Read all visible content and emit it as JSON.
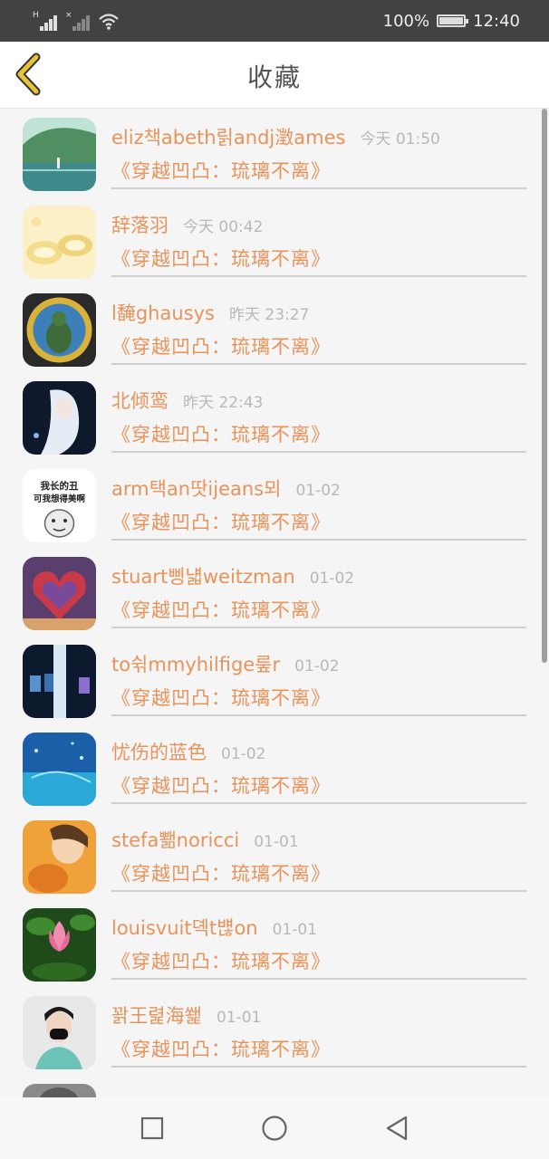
{
  "status_bar": {
    "battery": "100%",
    "time": "12:40"
  },
  "header": {
    "title": "收藏"
  },
  "items": [
    {
      "name": "eliz책abeth릵andj澂ames",
      "time": "今天 01:50",
      "book": "《穿越凹凸：琉璃不离》"
    },
    {
      "name": "辞落羽",
      "time": "今天 00:42",
      "book": "《穿越凹凸：琉璃不离》"
    },
    {
      "name": "l馣ghausys",
      "time": "昨天 23:27",
      "book": "《穿越凹凸：琉璃不离》"
    },
    {
      "name": "北倾鸾",
      "time": "昨天 22:43",
      "book": "《穿越凹凸：琉璃不离》"
    },
    {
      "name": "arm택an땃ijeans뫼",
      "time": "01-02",
      "book": "《穿越凹凸：琉璃不离》",
      "avatar_text": [
        "我长的丑",
        "可我想得美啊"
      ]
    },
    {
      "name": "stuart삥냷weitzman",
      "time": "01-02",
      "book": "《穿越凹凸：琉璃不离》"
    },
    {
      "name": "to쉮mmyhilfige뤂r",
      "time": "01-02",
      "book": "《穿越凹凸：琉璃不离》"
    },
    {
      "name": "忧伤的蓝色",
      "time": "01-02",
      "book": "《穿越凹凸：琉璃不离》"
    },
    {
      "name": "stefa뾂noricci",
      "time": "01-01",
      "book": "《穿越凹凸：琉璃不离》"
    },
    {
      "name": "louisvuit뎩t뱮on",
      "time": "01-01",
      "book": "《穿越凹凸：琉璃不离》"
    },
    {
      "name": "꽑王렱海쐝",
      "time": "01-01",
      "book": "《穿越凹凸：琉璃不离》"
    },
    {
      "name": "",
      "time": "",
      "book": ""
    }
  ],
  "icons": {
    "back": "chevron-left-icon",
    "nav_recent": "square-icon",
    "nav_home": "circle-icon",
    "nav_back": "triangle-back-icon"
  },
  "colors": {
    "accent": "#e8935a",
    "back_arrow": "#e8c235",
    "statusbar": "#424242"
  }
}
